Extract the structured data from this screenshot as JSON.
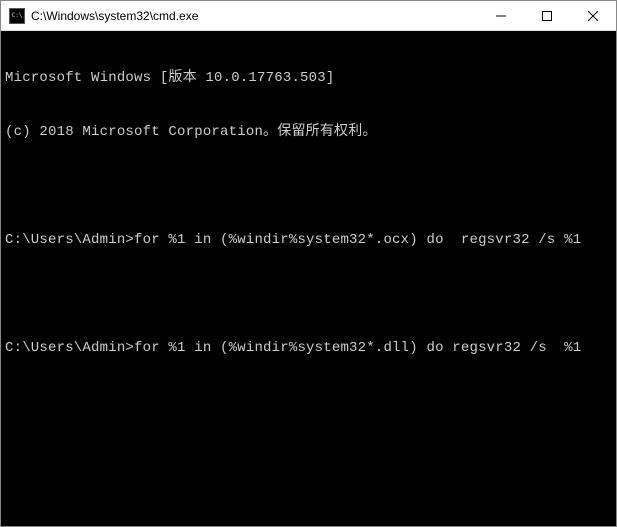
{
  "window": {
    "title": "C:\\Windows\\system32\\cmd.exe",
    "icon_label": "C:\\"
  },
  "controls": {
    "minimize": "—",
    "maximize": "□",
    "close": "✕"
  },
  "terminal": {
    "lines": [
      "Microsoft Windows [版本 10.0.17763.503]",
      "(c) 2018 Microsoft Corporation。保留所有权利。",
      "",
      "C:\\Users\\Admin>for %1 in (%windir%system32*.ocx) do  regsvr32 /s %1",
      "",
      "C:\\Users\\Admin>for %1 in (%windir%system32*.dll) do regsvr32 /s  %1"
    ]
  }
}
